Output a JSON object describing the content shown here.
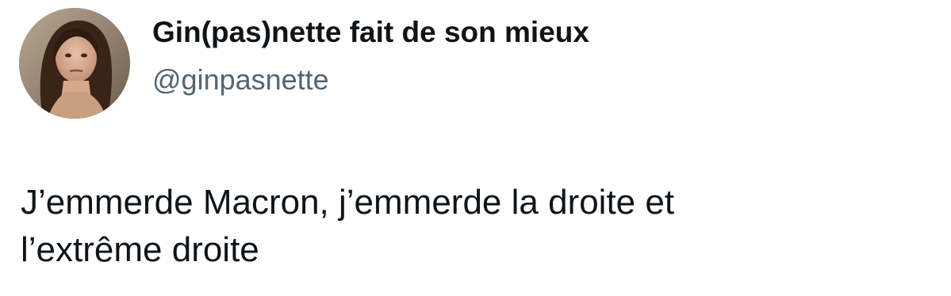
{
  "author": {
    "display_name": "Gin(pas)nette fait de son mieux",
    "handle": "@ginpasnette",
    "avatar_icon": "profile-photo"
  },
  "tweet": {
    "text": "J’emmerde Macron, j’emmerde la droite et\nl’extrême droite"
  },
  "colors": {
    "name": "#0f1419",
    "handle": "#536471",
    "background": "#ffffff"
  }
}
